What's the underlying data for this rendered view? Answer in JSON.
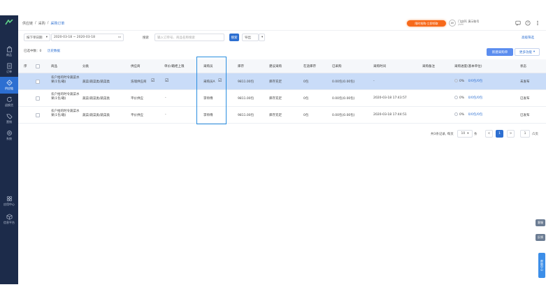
{
  "sidebar": {
    "items": [
      {
        "label": "商品",
        "icon": "bag-icon"
      },
      {
        "label": "订单",
        "icon": "order-icon"
      },
      {
        "label": "供应链",
        "icon": "swap-icon"
      },
      {
        "label": "退换货",
        "icon": "refresh-icon"
      },
      {
        "label": "营销",
        "icon": "tag-icon"
      },
      {
        "label": "系统",
        "icon": "gear-icon"
      },
      {
        "label": "应用中心",
        "icon": "apps-icon"
      },
      {
        "label": "信息平台",
        "icon": "cube-icon"
      }
    ]
  },
  "header": {
    "breadcrumb": [
      "供应链",
      "采购",
      "采购订单"
    ],
    "promo": "限时抢购·立即领取",
    "user_name": "门店01 演示账号",
    "user_sub": "yizhi"
  },
  "filter": {
    "date_type": "按下单日期",
    "date_range": "2020-03-18 ~ 2020-03-18",
    "search_label": "搜索",
    "search_placeholder": "输入订单号、商品名称搜索",
    "search_button": "搜索",
    "export_button": "导出",
    "advanced": "高级筛选"
  },
  "toolbar": {
    "count_label": "已选中数：0",
    "history": "历史数据",
    "new_button": "新建采购单",
    "more_button": "更多功能"
  },
  "table": {
    "headers": [
      "序",
      "",
      "商品",
      "分类",
      "供应商",
      "单价/箱柜上限",
      "采购员",
      "库存",
      "建议采购",
      "在途库存",
      "已采购",
      "采购时间",
      "采购备注",
      "采购进度(基本单位)",
      "状态"
    ],
    "rows": [
      {
        "product": "农户拾的时令蔬菜水果(1包/箱)",
        "category": "蔬菜/蔬菜类/蔬菜类",
        "supplier": "浩瑞供应商",
        "limit": "",
        "buyer": "采购员A",
        "stock": "9811.00包",
        "suggest": "库存充足",
        "transit": "0包",
        "purchased": "0.00包(0.00包)",
        "time": "-",
        "remark": "",
        "progress": "0%",
        "progress_val": "0/0包/0包",
        "status": "未发布",
        "selected": true
      },
      {
        "product": "农户拾的时令蔬菜水果(1包/箱)",
        "category": "蔬菜/蔬菜类/蔬菜类",
        "supplier": "平价供应",
        "limit": "-",
        "buyer": "李师傅",
        "stock": "9811.00包",
        "suggest": "库存充足",
        "transit": "0包",
        "purchased": "0.00包(0.00包)",
        "time": "2020-03-18 17:43:57",
        "remark": "",
        "progress": "0%",
        "progress_val": "0/0包/0包",
        "status": "已发布",
        "selected": false
      },
      {
        "product": "农户拾的时令蔬菜水果(1包/箱)",
        "category": "蔬菜/蔬菜类/蔬菜类",
        "supplier": "平价供应",
        "limit": "-",
        "buyer": "李师傅",
        "stock": "9811.00包",
        "suggest": "库存充足",
        "transit": "0包",
        "purchased": "0.00包(0.00包)",
        "time": "2020-03-18 17:44:51",
        "remark": "",
        "progress": "0%",
        "progress_val": "0/0包/0包",
        "status": "已发布",
        "selected": false
      }
    ]
  },
  "pagination": {
    "summary": "共3条记录, 每页",
    "page_size": "10",
    "unit": "条",
    "prev": "<",
    "current": "1",
    "next": ">",
    "jump_value": "1",
    "jump_label": "/1页"
  },
  "floaters": {
    "a": "客服",
    "b": "反馈",
    "c": "帮助中心"
  }
}
